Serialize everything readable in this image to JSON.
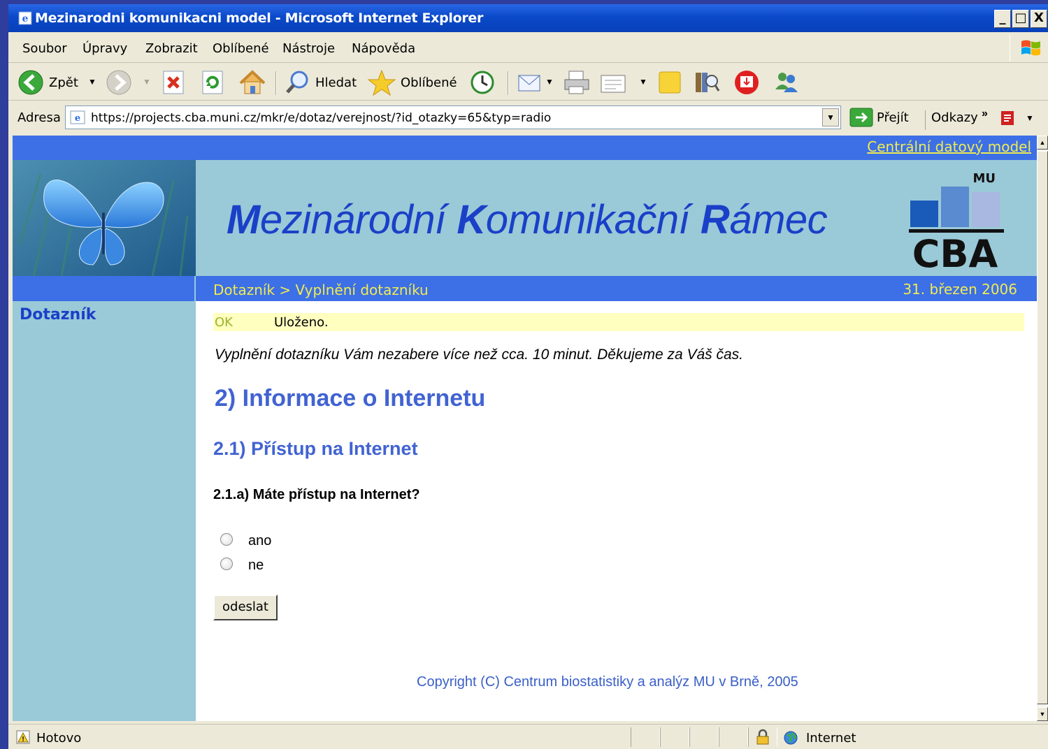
{
  "window": {
    "title": "Mezinarodni komunikacni model - Microsoft Internet Explorer",
    "buttons": [
      "_",
      "□",
      "X"
    ]
  },
  "menu": [
    "Soubor",
    "Úpravy",
    "Zobrazit",
    "Oblíbené",
    "Nástroje",
    "Nápověda"
  ],
  "toolbar": {
    "back_label": "Zpět",
    "search_label": "Hledat",
    "favorites_label": "Oblíbené"
  },
  "address": {
    "label": "Adresa",
    "url": "https://projects.cba.muni.cz/mkr/e/dotaz/verejnost/?id_otazky=65&typ=radio",
    "go_label": "Přejít",
    "links_label": "Odkazy",
    "links_chevron": "»"
  },
  "page": {
    "top_link": "Centrální datový model",
    "banner_title": {
      "w1_initial": "M",
      "w1_rest": "ezinárodní ",
      "w2_initial": "K",
      "w2_rest": "omunikační ",
      "w3_initial": "R",
      "w3_rest": "ámec"
    },
    "logo": {
      "top": "MU",
      "main": "CBA"
    },
    "breadcrumb": "Dotazník > Vyplnění dotazníku",
    "date": "31. březen 2006",
    "sidebar_title": "Dotazník",
    "status": {
      "code": "OK",
      "message": "Uloženo."
    },
    "intro": "Vyplnění dotazníku Vám nezabere více než cca. 10 minut. Děkujeme za Váš čas.",
    "section_title": "2) Informace o Internetu",
    "subsection_title": "2.1) Přístup na Internet",
    "question": "2.1.a) Máte přístup na Internet?",
    "options": [
      "ano",
      "ne"
    ],
    "submit_label": "odeslat",
    "copyright": "Copyright (C) Centrum biostatistiky a analýz MU v Brně, 2005"
  },
  "statusbar": {
    "text": "Hotovo",
    "zone": "Internet"
  },
  "colors": {
    "title_bar": "#0a49c9",
    "page_blue": "#3d6fe6",
    "banner_bg": "#9ac9d8",
    "link_yellow": "#f0ec50",
    "heading_blue": "#4163d2",
    "status_bg": "#ffffc0"
  }
}
